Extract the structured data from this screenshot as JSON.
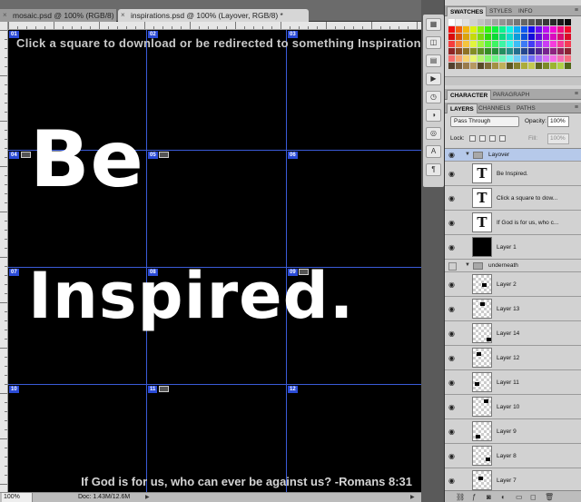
{
  "document_tabs": [
    {
      "label": "mosaic.psd @ 100% (RGB/8)",
      "close": "×"
    },
    {
      "label": "inspirations.psd @ 100% (Layover, RGB/8) *",
      "close": "×"
    }
  ],
  "canvas": {
    "headline": "Click a square to download or be redirected to something Inspirational",
    "word_1": "Be",
    "word_2": "Inspired.",
    "verse": "If God is for us, who can ever be against us? -Romans 8:31",
    "slice_labels": [
      "01",
      "02",
      "03",
      "04",
      "05",
      "06",
      "07",
      "08",
      "09",
      "10",
      "11",
      "12"
    ],
    "guide_color": "#3a5bd8",
    "slice_color": "#2b4bd6"
  },
  "status_bar": {
    "zoom": "100%",
    "doc_size": "Doc: 1.43M/12.6M"
  },
  "panels": {
    "swatch_tabs": [
      "SWATCHES",
      "STYLES",
      "INFO"
    ],
    "char_tabs": [
      "CHARACTER",
      "PARAGRAPH"
    ],
    "layer_tabs": [
      "LAYERS",
      "CHANNELS",
      "PATHS"
    ],
    "blend_mode": "Pass Through",
    "opacity_label": "Opacity:",
    "opacity_value": "100%",
    "lock_label": "Lock:",
    "fill_label": "Fill:",
    "fill_value": "100%",
    "menu_icon": "≡"
  },
  "layers": [
    {
      "name": "Layover",
      "kind": "group"
    },
    {
      "name": "Be Inspired.",
      "kind": "text"
    },
    {
      "name": "Click a square to dow...",
      "kind": "text"
    },
    {
      "name": "If God is for us, who c...",
      "kind": "text"
    },
    {
      "name": "Layer 1",
      "kind": "black"
    },
    {
      "name": "underneath",
      "kind": "group-hidden"
    },
    {
      "name": "Layer 2",
      "kind": "pixel"
    },
    {
      "name": "Layer 13",
      "kind": "pixel"
    },
    {
      "name": "Layer 14",
      "kind": "pixel"
    },
    {
      "name": "Layer 12",
      "kind": "pixel"
    },
    {
      "name": "Layer 11",
      "kind": "pixel"
    },
    {
      "name": "Layer 10",
      "kind": "pixel"
    },
    {
      "name": "Layer 9",
      "kind": "pixel"
    },
    {
      "name": "Layer 8",
      "kind": "pixel"
    },
    {
      "name": "Layer 7",
      "kind": "pixel"
    }
  ],
  "tool_icons": [
    "brush-presets-icon",
    "clone-source-icon",
    "layer-comps-icon",
    "actions-icon",
    "history-icon",
    "adjustments-icon",
    "masks-icon",
    "character-icon",
    "paragraph-icon"
  ]
}
